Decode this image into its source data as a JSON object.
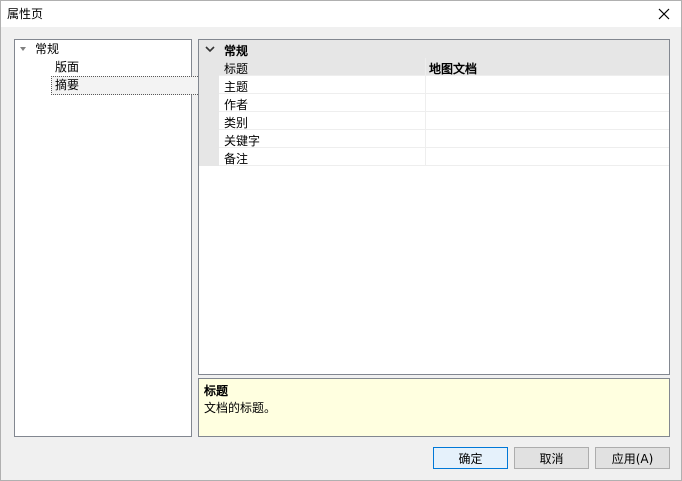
{
  "window": {
    "title": "属性页"
  },
  "tree": {
    "root": {
      "label": "常规",
      "expanded": true
    },
    "children": [
      {
        "label": "版面",
        "selected": false
      },
      {
        "label": "摘要",
        "selected": true
      }
    ]
  },
  "grid": {
    "category": "常规",
    "rows": [
      {
        "name": "标题",
        "value": "地图文档"
      },
      {
        "name": "主题",
        "value": ""
      },
      {
        "name": "作者",
        "value": ""
      },
      {
        "name": "类别",
        "value": ""
      },
      {
        "name": "关键字",
        "value": ""
      },
      {
        "name": "备注",
        "value": ""
      }
    ]
  },
  "description": {
    "title": "标题",
    "text": "文档的标题。"
  },
  "buttons": {
    "ok": "确定",
    "cancel": "取消",
    "apply": "应用(A)"
  },
  "icons": {
    "close": "close-icon",
    "collapse": "chevron-down-icon",
    "tree_expanded": "triangle-expanded-icon"
  }
}
